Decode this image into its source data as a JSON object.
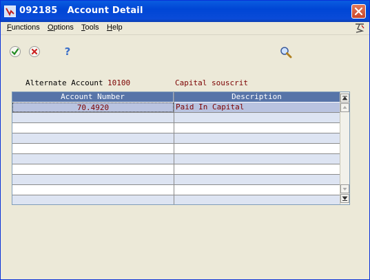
{
  "window": {
    "title": "092185   Account Detail"
  },
  "menu": {
    "items": [
      {
        "first": "F",
        "rest": "unctions"
      },
      {
        "first": "O",
        "rest": "ptions"
      },
      {
        "first": "T",
        "rest": "ools"
      },
      {
        "first": "H",
        "rest": "elp"
      }
    ]
  },
  "toolbar": {
    "ok_icon": "checkmark-icon",
    "cancel_icon": "cancel-x-icon",
    "help_icon": "question-icon",
    "find_icon": "magnifier-icon"
  },
  "header": {
    "alt_account_label": "Alternate Account",
    "alt_account_value": "10100",
    "alt_account_desc": "Capital souscrit"
  },
  "grid": {
    "columns": [
      "Account Number",
      "Description"
    ],
    "rows": [
      {
        "account": "70.4920",
        "description": "Paid In Capital"
      },
      {
        "account": "",
        "description": ""
      },
      {
        "account": "",
        "description": ""
      },
      {
        "account": "",
        "description": ""
      },
      {
        "account": "",
        "description": ""
      },
      {
        "account": "",
        "description": ""
      },
      {
        "account": "",
        "description": ""
      },
      {
        "account": "",
        "description": ""
      },
      {
        "account": "",
        "description": ""
      },
      {
        "account": "",
        "description": ""
      }
    ]
  },
  "colors": {
    "title_bar": "#0a4bd8",
    "grid_header": "#5774a8",
    "value_text": "#7b0000"
  }
}
